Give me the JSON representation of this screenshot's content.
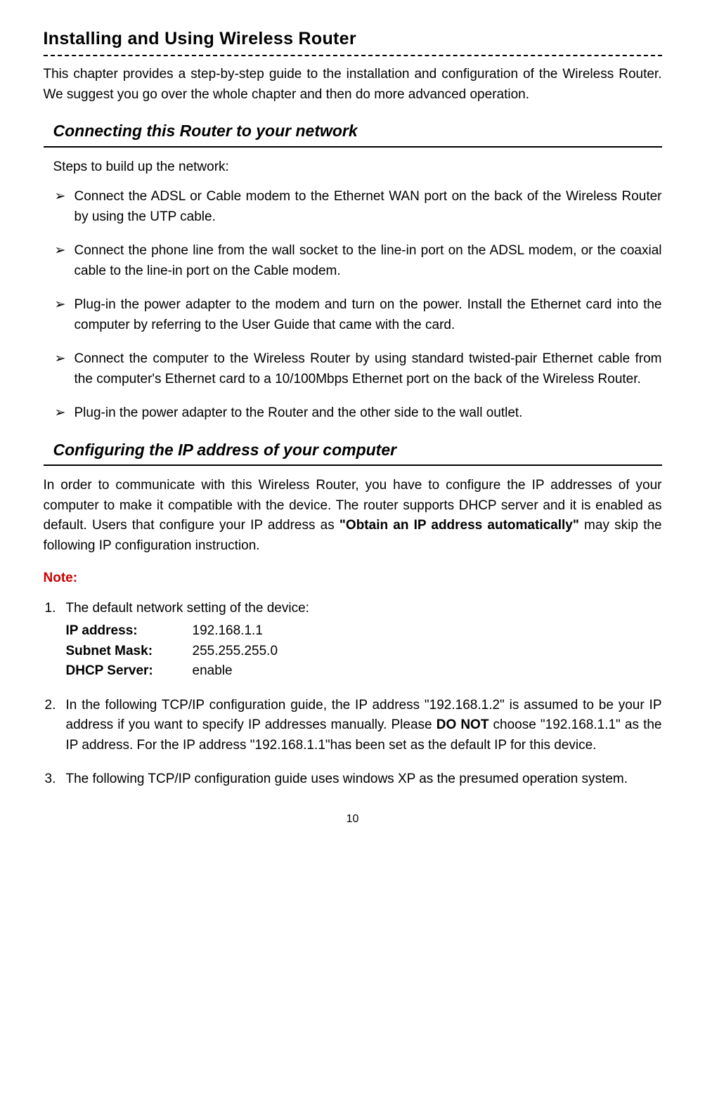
{
  "title": "Installing and Using Wireless Router",
  "intro": "This chapter provides a step-by-step guide to the installation and configuration of the Wireless Router. We suggest you go over the whole chapter and then do more advanced operation.",
  "section1": {
    "heading": "Connecting this Router to your network",
    "lead": "Steps to build up the network:",
    "steps": [
      "Connect the ADSL or Cable modem to the Ethernet WAN port on the back of the Wireless Router by using the UTP cable.",
      "Connect the phone line from the wall socket to the line-in port on the ADSL modem, or the coaxial cable to the line-in port on the Cable modem.",
      "Plug-in the power adapter to the modem and turn on the power. Install the Ethernet card into the computer by referring to the User Guide that came with the card.",
      "Connect the computer to the Wireless Router by using standard twisted-pair Ethernet cable from the computer's Ethernet card to a 10/100Mbps Ethernet port on the back of the Wireless Router.",
      "Plug-in the power adapter to the Router and the other side to the wall outlet."
    ]
  },
  "section2": {
    "heading": "Configuring the IP address of your computer",
    "para_pre": "In order to communicate with this Wireless Router, you have to configure the IP addresses of your computer to make it compatible with the device. The router supports DHCP server and it is enabled as default. Users that configure your IP address as ",
    "para_bold": "\"Obtain an IP address automatically\"",
    "para_post": " may skip the following IP configuration instruction.",
    "note_label": "Note:",
    "item1_lead": "The default network setting of the device:",
    "settings": {
      "ip_label": "IP address:",
      "ip_value": "192.168.1.1",
      "mask_label": "Subnet Mask:",
      "mask_value": "255.255.255.0",
      "dhcp_label": "DHCP Server:",
      "dhcp_value": "enable"
    },
    "item2_pre": "In the following TCP/IP configuration guide, the IP address \"192.168.1.2\" is assumed to be your IP address if you want to specify IP addresses manually. Please ",
    "item2_donot": "DO NOT",
    "item2_post": " choose \"192.168.1.1\" as the IP address. For the IP address \"192.168.1.1\"has been set as the default IP for this device.",
    "item3": "The following TCP/IP configuration guide uses windows XP as the presumed operation system."
  },
  "page_number": "10"
}
